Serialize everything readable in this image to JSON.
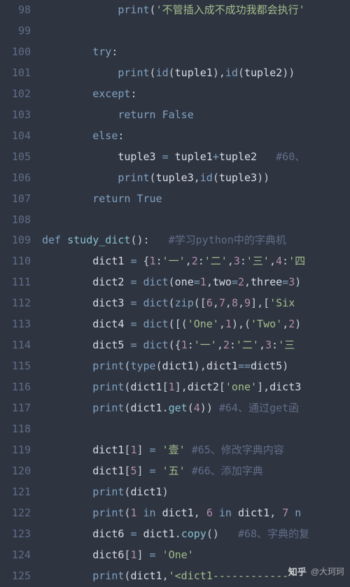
{
  "startLine": 98,
  "lines": [
    {
      "indent": 12,
      "segs": [
        {
          "t": "print",
          "c": "bn"
        },
        {
          "t": "(",
          "c": "pn"
        },
        {
          "t": "'不管插入成不成功我都会执行'",
          "c": "str"
        }
      ]
    },
    {
      "indent": 0,
      "segs": []
    },
    {
      "indent": 8,
      "segs": [
        {
          "t": "try",
          "c": "kw"
        },
        {
          "t": ":",
          "c": "pn"
        }
      ]
    },
    {
      "indent": 12,
      "segs": [
        {
          "t": "print",
          "c": "bn"
        },
        {
          "t": "(",
          "c": "pn"
        },
        {
          "t": "id",
          "c": "bn"
        },
        {
          "t": "(",
          "c": "pn"
        },
        {
          "t": "tuple1",
          "c": "id"
        },
        {
          "t": ")",
          "c": "pn"
        },
        {
          "t": ",",
          "c": "pn"
        },
        {
          "t": "id",
          "c": "bn"
        },
        {
          "t": "(",
          "c": "pn"
        },
        {
          "t": "tuple2",
          "c": "id"
        },
        {
          "t": ")",
          "c": "pn"
        },
        {
          "t": ")",
          "c": "pn"
        }
      ]
    },
    {
      "indent": 8,
      "segs": [
        {
          "t": "except",
          "c": "kw"
        },
        {
          "t": ":",
          "c": "pn"
        }
      ]
    },
    {
      "indent": 12,
      "segs": [
        {
          "t": "return",
          "c": "kw"
        },
        {
          "t": " ",
          "c": "id"
        },
        {
          "t": "False",
          "c": "kw"
        }
      ]
    },
    {
      "indent": 8,
      "segs": [
        {
          "t": "else",
          "c": "kw"
        },
        {
          "t": ":",
          "c": "pn"
        }
      ]
    },
    {
      "indent": 12,
      "segs": [
        {
          "t": "tuple3",
          "c": "id"
        },
        {
          "t": " ",
          "c": "id"
        },
        {
          "t": "=",
          "c": "op"
        },
        {
          "t": " ",
          "c": "id"
        },
        {
          "t": "tuple1",
          "c": "id"
        },
        {
          "t": "+",
          "c": "op"
        },
        {
          "t": "tuple2",
          "c": "id"
        },
        {
          "t": "   ",
          "c": "id"
        },
        {
          "t": "#60、",
          "c": "cm"
        }
      ]
    },
    {
      "indent": 12,
      "segs": [
        {
          "t": "print",
          "c": "bn"
        },
        {
          "t": "(",
          "c": "pn"
        },
        {
          "t": "tuple3",
          "c": "id"
        },
        {
          "t": ",",
          "c": "pn"
        },
        {
          "t": "id",
          "c": "bn"
        },
        {
          "t": "(",
          "c": "pn"
        },
        {
          "t": "tuple3",
          "c": "id"
        },
        {
          "t": ")",
          "c": "pn"
        },
        {
          "t": ")",
          "c": "pn"
        }
      ]
    },
    {
      "indent": 8,
      "segs": [
        {
          "t": "return",
          "c": "kw"
        },
        {
          "t": " ",
          "c": "id"
        },
        {
          "t": "True",
          "c": "kw"
        }
      ]
    },
    {
      "indent": 0,
      "segs": []
    },
    {
      "indent": 0,
      "segs": [
        {
          "t": "def",
          "c": "kw"
        },
        {
          "t": " ",
          "c": "id"
        },
        {
          "t": "study_dict",
          "c": "fn"
        },
        {
          "t": "()",
          "c": "pn"
        },
        {
          "t": ":",
          "c": "pn"
        },
        {
          "t": "   ",
          "c": "id"
        },
        {
          "t": "#学习python中的字典机",
          "c": "cm"
        }
      ]
    },
    {
      "indent": 8,
      "segs": [
        {
          "t": "dict1",
          "c": "id"
        },
        {
          "t": " ",
          "c": "id"
        },
        {
          "t": "=",
          "c": "op"
        },
        {
          "t": " ",
          "c": "id"
        },
        {
          "t": "{",
          "c": "pn"
        },
        {
          "t": "1",
          "c": "num"
        },
        {
          "t": ":",
          "c": "pn"
        },
        {
          "t": "'一'",
          "c": "str"
        },
        {
          "t": ",",
          "c": "pn"
        },
        {
          "t": "2",
          "c": "num"
        },
        {
          "t": ":",
          "c": "pn"
        },
        {
          "t": "'二'",
          "c": "str"
        },
        {
          "t": ",",
          "c": "pn"
        },
        {
          "t": "3",
          "c": "num"
        },
        {
          "t": ":",
          "c": "pn"
        },
        {
          "t": "'三'",
          "c": "str"
        },
        {
          "t": ",",
          "c": "pn"
        },
        {
          "t": "4",
          "c": "num"
        },
        {
          "t": ":",
          "c": "pn"
        },
        {
          "t": "'四",
          "c": "str"
        }
      ]
    },
    {
      "indent": 8,
      "segs": [
        {
          "t": "dict2",
          "c": "id"
        },
        {
          "t": " ",
          "c": "id"
        },
        {
          "t": "=",
          "c": "op"
        },
        {
          "t": " ",
          "c": "id"
        },
        {
          "t": "dict",
          "c": "bn"
        },
        {
          "t": "(",
          "c": "pn"
        },
        {
          "t": "one",
          "c": "id"
        },
        {
          "t": "=",
          "c": "op"
        },
        {
          "t": "1",
          "c": "num"
        },
        {
          "t": ",",
          "c": "pn"
        },
        {
          "t": "two",
          "c": "id"
        },
        {
          "t": "=",
          "c": "op"
        },
        {
          "t": "2",
          "c": "num"
        },
        {
          "t": ",",
          "c": "pn"
        },
        {
          "t": "three",
          "c": "id"
        },
        {
          "t": "=",
          "c": "op"
        },
        {
          "t": "3",
          "c": "num"
        },
        {
          "t": ")",
          "c": "pn"
        }
      ]
    },
    {
      "indent": 8,
      "segs": [
        {
          "t": "dict3",
          "c": "id"
        },
        {
          "t": " ",
          "c": "id"
        },
        {
          "t": "=",
          "c": "op"
        },
        {
          "t": " ",
          "c": "id"
        },
        {
          "t": "dict",
          "c": "bn"
        },
        {
          "t": "(",
          "c": "pn"
        },
        {
          "t": "zip",
          "c": "bn"
        },
        {
          "t": "(",
          "c": "pn"
        },
        {
          "t": "[",
          "c": "pn"
        },
        {
          "t": "6",
          "c": "num"
        },
        {
          "t": ",",
          "c": "pn"
        },
        {
          "t": "7",
          "c": "num"
        },
        {
          "t": ",",
          "c": "pn"
        },
        {
          "t": "8",
          "c": "num"
        },
        {
          "t": ",",
          "c": "pn"
        },
        {
          "t": "9",
          "c": "num"
        },
        {
          "t": "]",
          "c": "pn"
        },
        {
          "t": ",",
          "c": "pn"
        },
        {
          "t": "[",
          "c": "pn"
        },
        {
          "t": "'Six",
          "c": "str"
        }
      ]
    },
    {
      "indent": 8,
      "segs": [
        {
          "t": "dict4",
          "c": "id"
        },
        {
          "t": " ",
          "c": "id"
        },
        {
          "t": "=",
          "c": "op"
        },
        {
          "t": " ",
          "c": "id"
        },
        {
          "t": "dict",
          "c": "bn"
        },
        {
          "t": "(",
          "c": "pn"
        },
        {
          "t": "[",
          "c": "pn"
        },
        {
          "t": "(",
          "c": "pn"
        },
        {
          "t": "'One'",
          "c": "str"
        },
        {
          "t": ",",
          "c": "pn"
        },
        {
          "t": "1",
          "c": "num"
        },
        {
          "t": ")",
          "c": "pn"
        },
        {
          "t": ",",
          "c": "pn"
        },
        {
          "t": "(",
          "c": "pn"
        },
        {
          "t": "'Two'",
          "c": "str"
        },
        {
          "t": ",",
          "c": "pn"
        },
        {
          "t": "2",
          "c": "num"
        },
        {
          "t": ")",
          "c": "pn"
        }
      ]
    },
    {
      "indent": 8,
      "segs": [
        {
          "t": "dict5",
          "c": "id"
        },
        {
          "t": " ",
          "c": "id"
        },
        {
          "t": "=",
          "c": "op"
        },
        {
          "t": " ",
          "c": "id"
        },
        {
          "t": "dict",
          "c": "bn"
        },
        {
          "t": "(",
          "c": "pn"
        },
        {
          "t": "{",
          "c": "pn"
        },
        {
          "t": "1",
          "c": "num"
        },
        {
          "t": ":",
          "c": "pn"
        },
        {
          "t": "'一'",
          "c": "str"
        },
        {
          "t": ",",
          "c": "pn"
        },
        {
          "t": "2",
          "c": "num"
        },
        {
          "t": ":",
          "c": "pn"
        },
        {
          "t": "'二'",
          "c": "str"
        },
        {
          "t": ",",
          "c": "pn"
        },
        {
          "t": "3",
          "c": "num"
        },
        {
          "t": ":",
          "c": "pn"
        },
        {
          "t": "'三",
          "c": "str"
        }
      ]
    },
    {
      "indent": 8,
      "segs": [
        {
          "t": "print",
          "c": "bn"
        },
        {
          "t": "(",
          "c": "pn"
        },
        {
          "t": "type",
          "c": "bn"
        },
        {
          "t": "(",
          "c": "pn"
        },
        {
          "t": "dict1",
          "c": "id"
        },
        {
          "t": ")",
          "c": "pn"
        },
        {
          "t": ",",
          "c": "pn"
        },
        {
          "t": "dict1",
          "c": "id"
        },
        {
          "t": "==",
          "c": "op"
        },
        {
          "t": "dict5",
          "c": "id"
        },
        {
          "t": ")",
          "c": "pn"
        }
      ]
    },
    {
      "indent": 8,
      "segs": [
        {
          "t": "print",
          "c": "bn"
        },
        {
          "t": "(",
          "c": "pn"
        },
        {
          "t": "dict1",
          "c": "id"
        },
        {
          "t": "[",
          "c": "pn"
        },
        {
          "t": "1",
          "c": "num"
        },
        {
          "t": "]",
          "c": "pn"
        },
        {
          "t": ",",
          "c": "pn"
        },
        {
          "t": "dict2",
          "c": "id"
        },
        {
          "t": "[",
          "c": "pn"
        },
        {
          "t": "'one'",
          "c": "str"
        },
        {
          "t": "]",
          "c": "pn"
        },
        {
          "t": ",",
          "c": "pn"
        },
        {
          "t": "dict3",
          "c": "id"
        }
      ]
    },
    {
      "indent": 8,
      "segs": [
        {
          "t": "print",
          "c": "bn"
        },
        {
          "t": "(",
          "c": "pn"
        },
        {
          "t": "dict1",
          "c": "id"
        },
        {
          "t": ".",
          "c": "pn"
        },
        {
          "t": "get",
          "c": "fn"
        },
        {
          "t": "(",
          "c": "pn"
        },
        {
          "t": "4",
          "c": "num"
        },
        {
          "t": ")",
          "c": "pn"
        },
        {
          "t": ")",
          "c": "pn"
        },
        {
          "t": " ",
          "c": "id"
        },
        {
          "t": "#64、通过get函",
          "c": "cm"
        }
      ]
    },
    {
      "indent": 0,
      "segs": []
    },
    {
      "indent": 8,
      "segs": [
        {
          "t": "dict1",
          "c": "id"
        },
        {
          "t": "[",
          "c": "pn"
        },
        {
          "t": "1",
          "c": "num"
        },
        {
          "t": "]",
          "c": "pn"
        },
        {
          "t": " ",
          "c": "id"
        },
        {
          "t": "=",
          "c": "op"
        },
        {
          "t": " ",
          "c": "id"
        },
        {
          "t": "'壹'",
          "c": "str"
        },
        {
          "t": " ",
          "c": "id"
        },
        {
          "t": "#65、修改字典内容",
          "c": "cm"
        }
      ]
    },
    {
      "indent": 8,
      "segs": [
        {
          "t": "dict1",
          "c": "id"
        },
        {
          "t": "[",
          "c": "pn"
        },
        {
          "t": "5",
          "c": "num"
        },
        {
          "t": "]",
          "c": "pn"
        },
        {
          "t": " ",
          "c": "id"
        },
        {
          "t": "=",
          "c": "op"
        },
        {
          "t": " ",
          "c": "id"
        },
        {
          "t": "'五'",
          "c": "str"
        },
        {
          "t": " ",
          "c": "id"
        },
        {
          "t": "#66、添加字典",
          "c": "cm"
        }
      ]
    },
    {
      "indent": 8,
      "segs": [
        {
          "t": "print",
          "c": "bn"
        },
        {
          "t": "(",
          "c": "pn"
        },
        {
          "t": "dict1",
          "c": "id"
        },
        {
          "t": ")",
          "c": "pn"
        }
      ]
    },
    {
      "indent": 8,
      "segs": [
        {
          "t": "print",
          "c": "bn"
        },
        {
          "t": "(",
          "c": "pn"
        },
        {
          "t": "1",
          "c": "num"
        },
        {
          "t": " ",
          "c": "id"
        },
        {
          "t": "in",
          "c": "kw"
        },
        {
          "t": " ",
          "c": "id"
        },
        {
          "t": "dict1",
          "c": "id"
        },
        {
          "t": ",",
          "c": "pn"
        },
        {
          "t": " ",
          "c": "id"
        },
        {
          "t": "6",
          "c": "num"
        },
        {
          "t": " ",
          "c": "id"
        },
        {
          "t": "in",
          "c": "kw"
        },
        {
          "t": " ",
          "c": "id"
        },
        {
          "t": "dict1",
          "c": "id"
        },
        {
          "t": ",",
          "c": "pn"
        },
        {
          "t": " ",
          "c": "id"
        },
        {
          "t": "7",
          "c": "num"
        },
        {
          "t": " ",
          "c": "id"
        },
        {
          "t": "n",
          "c": "kw"
        }
      ]
    },
    {
      "indent": 8,
      "segs": [
        {
          "t": "dict6",
          "c": "id"
        },
        {
          "t": " ",
          "c": "id"
        },
        {
          "t": "=",
          "c": "op"
        },
        {
          "t": " ",
          "c": "id"
        },
        {
          "t": "dict1",
          "c": "id"
        },
        {
          "t": ".",
          "c": "pn"
        },
        {
          "t": "copy",
          "c": "fn"
        },
        {
          "t": "()",
          "c": "pn"
        },
        {
          "t": "   ",
          "c": "id"
        },
        {
          "t": "#68、字典的复",
          "c": "cm"
        }
      ]
    },
    {
      "indent": 8,
      "segs": [
        {
          "t": "dict6",
          "c": "id"
        },
        {
          "t": "[",
          "c": "pn"
        },
        {
          "t": "1",
          "c": "num"
        },
        {
          "t": "]",
          "c": "pn"
        },
        {
          "t": " ",
          "c": "id"
        },
        {
          "t": "=",
          "c": "op"
        },
        {
          "t": " ",
          "c": "id"
        },
        {
          "t": "'One'",
          "c": "str"
        }
      ]
    },
    {
      "indent": 8,
      "segs": [
        {
          "t": "print",
          "c": "bn"
        },
        {
          "t": "(",
          "c": "pn"
        },
        {
          "t": "dict1",
          "c": "id"
        },
        {
          "t": ",",
          "c": "pn"
        },
        {
          "t": "'<dict1------------'",
          "c": "str"
        }
      ]
    }
  ],
  "watermark": {
    "logo": "知乎",
    "author": "@大珂珂"
  }
}
